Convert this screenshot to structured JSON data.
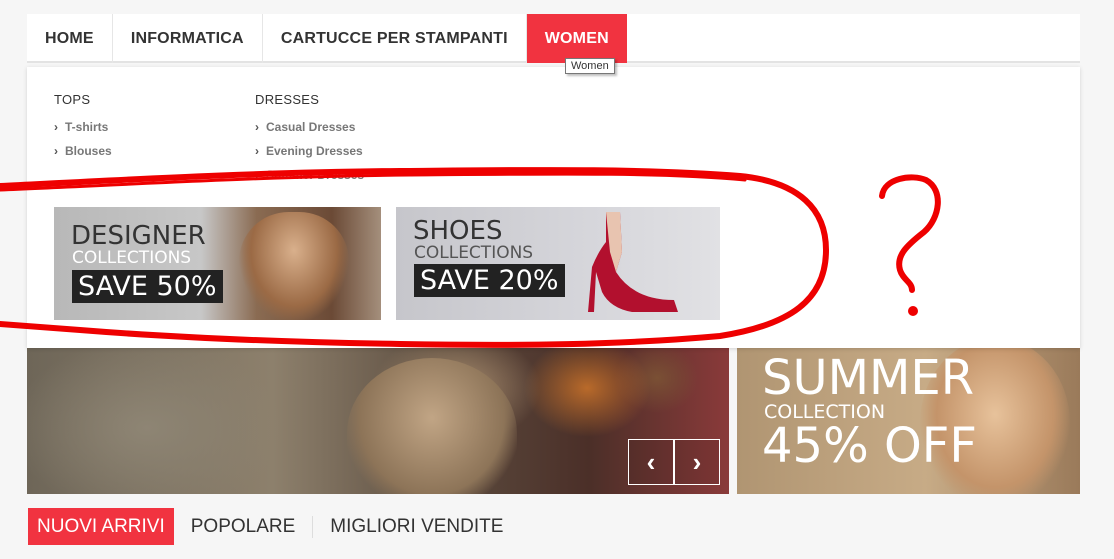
{
  "nav": {
    "items": [
      {
        "label": "HOME"
      },
      {
        "label": "INFORMATICA"
      },
      {
        "label": "CARTUCCE PER STAMPANTI"
      },
      {
        "label": "WOMEN",
        "active": true
      }
    ],
    "tooltip": "Women"
  },
  "mega_menu": {
    "columns": [
      {
        "heading": "TOPS",
        "items": [
          "T-shirts",
          "Blouses"
        ]
      },
      {
        "heading": "DRESSES",
        "items": [
          "Casual Dresses",
          "Evening Dresses",
          "Summer Dresses"
        ]
      }
    ],
    "banners": [
      {
        "title": "DESIGNER",
        "subtitle": "COLLECTIONS",
        "save": "SAVE 50%"
      },
      {
        "title": "SHOES",
        "subtitle": "COLLECTIONS",
        "save": "SAVE 20%"
      }
    ]
  },
  "slider": {
    "prev_icon": "chevron-left-icon",
    "next_icon": "chevron-right-icon"
  },
  "side_banner": {
    "line1": "SUMMER",
    "line2": "COLLECTION",
    "line3": "45% OFF"
  },
  "annotation": {
    "mark": "?"
  },
  "tabs": [
    {
      "label": "NUOVI ARRIVI",
      "active": true
    },
    {
      "label": "POPOLARE"
    },
    {
      "label": "MIGLIORI VENDITE"
    }
  ],
  "colors": {
    "accent": "#f13340",
    "annotation": "#ee0000"
  }
}
